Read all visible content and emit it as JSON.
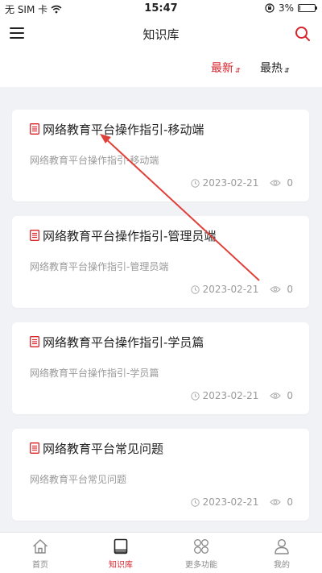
{
  "status_bar": {
    "carrier": "无 SIM 卡",
    "time": "15:47",
    "battery": "3%",
    "battery_level": 0.03
  },
  "navbar": {
    "title": "知识库"
  },
  "sort": {
    "newest": "最新",
    "hot": "最热",
    "sort_glyph": "⇵"
  },
  "articles": [
    {
      "title": "网络教育平台操作指引-移动端",
      "desc": "网络教育平台操作指引-移动端",
      "date": "2023-02-21",
      "views": "0"
    },
    {
      "title": "网络教育平台操作指引-管理员端",
      "desc": "网络教育平台操作指引-管理员端",
      "date": "2023-02-21",
      "views": "0"
    },
    {
      "title": "网络教育平台操作指引-学员篇",
      "desc": "网络教育平台操作指引-学员篇",
      "date": "2023-02-21",
      "views": "0"
    },
    {
      "title": "网络教育平台常见问题",
      "desc": "网络教育平台常见问题",
      "date": "2023-02-21",
      "views": "0"
    }
  ],
  "tabs": [
    {
      "label": "首页",
      "icon": "home-icon"
    },
    {
      "label": "知识库",
      "icon": "book-icon",
      "active": true
    },
    {
      "label": "更多功能",
      "icon": "grid-icon"
    },
    {
      "label": "我的",
      "icon": "user-icon"
    }
  ],
  "colors": {
    "accent": "#d8232a",
    "annotation": "#e0403a"
  }
}
